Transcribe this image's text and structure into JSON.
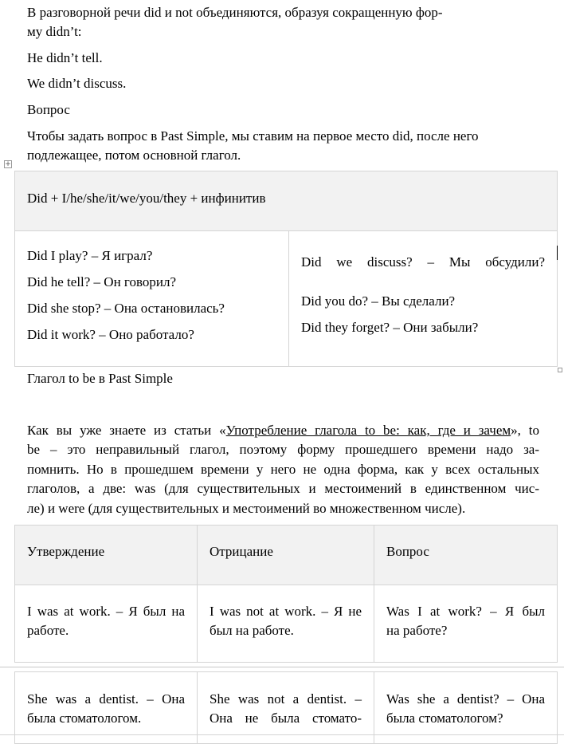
{
  "intro": {
    "line1": "В разговорной речи did и not объединяются, образуя сокращенную фор-",
    "line2": "му didn’t:",
    "example1": "He didn’t tell.",
    "example2": "We didn’t discuss."
  },
  "question_section": {
    "heading": "Вопрос",
    "text_line1": "Чтобы задать вопрос в Past Simple, мы ставим на первое место did, после него",
    "text_line2": "подлежащее, потом основной глагол."
  },
  "question_table": {
    "formula": "Did + I/he/she/it/we/you/they + инфинитив",
    "left": [
      "Did I play? – Я играл?",
      "Did he tell? – Он говорил?",
      "Did she stop? – Она остановилась?",
      "Did it work? – Оно работало?"
    ],
    "right": [
      "Did we discuss? – Мы обсудили?",
      "Did you do? – Вы сделали?",
      "Did they forget? – Они забыли?"
    ]
  },
  "to_be_section": {
    "heading": "Глагол to be в Past Simple",
    "para_start": "Как вы уже знаете из статьи «",
    "link_text": "Употребление глагола to be: как, где и зачем",
    "para_after_link": "», to",
    "lines": [
      "be – это неправильный глагол, поэтому форму прошедшего времени надо за-",
      "помнить. Но в прошедшем времени у него не одна форма, как у всех остальных",
      "глаголов, а две: was (для существительных и местоимений в единственном чис-",
      "ле) и were (для существительных и местоимений во множественном числе)."
    ]
  },
  "to_be_table": {
    "headers": [
      "Утверждение",
      "Отрицание",
      "Вопрос"
    ],
    "row1": [
      [
        "I was at work. – Я был на",
        "работе."
      ],
      [
        "I was not at work. – Я не",
        "был на работе."
      ],
      [
        "Was I at work? – Я был",
        "на работе?"
      ]
    ],
    "row2": [
      [
        "She was a dentist. – Она",
        "была стоматологом."
      ],
      [
        "She was not a dentist. –",
        "Она не была стомато-"
      ],
      [
        "Was she a dentist? – Она",
        "была стоматологом?"
      ]
    ]
  },
  "icons": {
    "table_anchor": "table-move-icon",
    "table_resize": "table-resize-icon"
  }
}
